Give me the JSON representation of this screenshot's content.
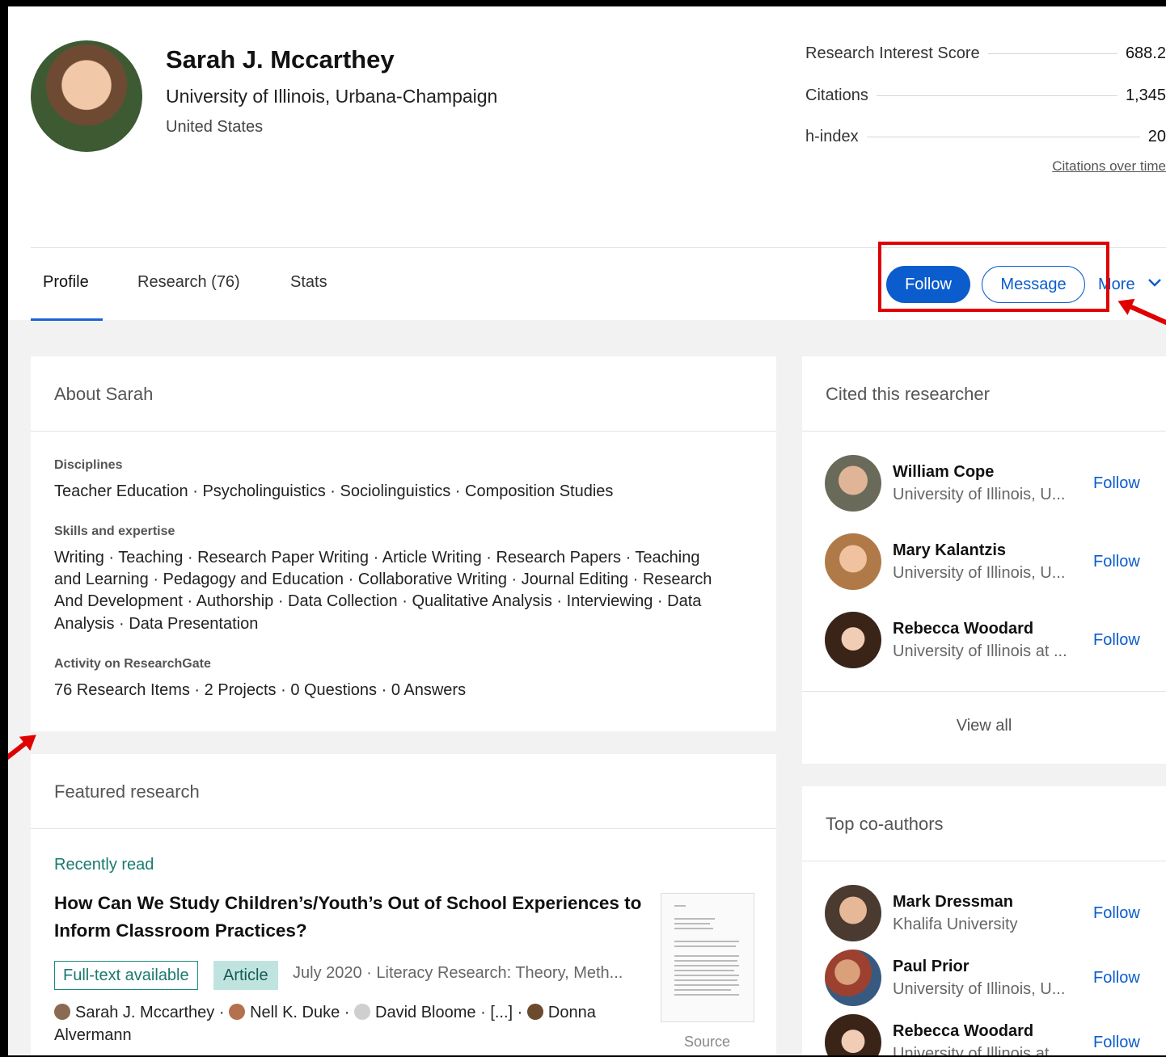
{
  "profile": {
    "name": "Sarah J. Mccarthey",
    "institution": "University of Illinois, Urbana-Champaign",
    "country": "United States"
  },
  "stats": [
    {
      "label": "Research Interest Score",
      "value": "688.2"
    },
    {
      "label": "Citations",
      "value": "1,345"
    },
    {
      "label": "h-index",
      "value": "20"
    }
  ],
  "citations_over_time": "Citations over time",
  "tabs": [
    "Profile",
    "Research (76)",
    "Stats"
  ],
  "actions": {
    "follow": "Follow",
    "message": "Message",
    "more": "More"
  },
  "about": {
    "title": "About Sarah",
    "disciplines_label": "Disciplines",
    "disciplines": "Teacher Education · Psycholinguistics · Sociolinguistics · Composition Studies",
    "skills_label": "Skills and expertise",
    "skills_lines": [
      "Writing · Teaching · Research Paper Writing · Article Writing · Research Papers · Teaching",
      "and Learning · Pedagogy and Education · Collaborative Writing · Journal Editing · Research",
      "And Development · Authorship · Data Collection · Qualitative Analysis · Interviewing · Data",
      "Analysis · Data Presentation"
    ],
    "activity_label": "Activity on ResearchGate",
    "activity": "76 Research Items · 2 Projects · 0 Questions · 0 Answers"
  },
  "featured": {
    "title": "Featured research",
    "recent": "Recently read",
    "paper_title": "How Can We Study Children’s/Youth’s Out of School Experiences to Inform Classroom Practices?",
    "badge_fulltext": "Full-text available",
    "badge_type": "Article",
    "meta": "July 2020 · Literacy Research: Theory, Meth...",
    "authors": [
      "Sarah J. Mccarthey",
      "Nell K. Duke",
      "David Bloome",
      "[...]",
      "Donna Alvermann"
    ],
    "source": "Source"
  },
  "cited": {
    "title": "Cited this researcher",
    "people": [
      {
        "name": "William Cope",
        "affiliation": "University of Illinois, U...",
        "follow": "Follow"
      },
      {
        "name": "Mary Kalantzis",
        "affiliation": "University of Illinois, U...",
        "follow": "Follow"
      },
      {
        "name": "Rebecca Woodard",
        "affiliation": "University of Illinois at ...",
        "follow": "Follow"
      }
    ],
    "view_all": "View all"
  },
  "coauthors": {
    "title": "Top co-authors",
    "people": [
      {
        "name": "Mark Dressman",
        "affiliation": "Khalifa University",
        "follow": "Follow"
      },
      {
        "name": "Paul Prior",
        "affiliation": "University of Illinois, U...",
        "follow": "Follow"
      },
      {
        "name": "Rebecca Woodard",
        "affiliation": "University of Illinois at",
        "follow": "Follow"
      }
    ]
  },
  "colors": {
    "accent": "#0b5ccc",
    "highlight": "#e00000",
    "teal": "#1a7a6e"
  }
}
